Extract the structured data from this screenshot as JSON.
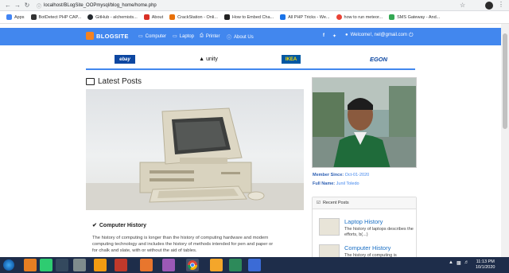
{
  "browser": {
    "url": "localhost/BLogSite_OOPmysql/blog_home/home.php",
    "bookmarks": [
      {
        "label": "Apps",
        "color": "#4285f4"
      },
      {
        "label": "BotDetect PHP CAP...",
        "color": "#333333"
      },
      {
        "label": "GitHub - alchemists...",
        "color": "#24292e"
      },
      {
        "label": "About",
        "color": "#d93025"
      },
      {
        "label": "CrackStation - Onli...",
        "color": "#e8710a"
      },
      {
        "label": "How to Embed Cha...",
        "color": "#222222"
      },
      {
        "label": "All PHP Tricks - We...",
        "color": "#1a73e8"
      },
      {
        "label": "how to run meteor...",
        "color": "#e94235"
      },
      {
        "label": "SMS Gateway - And...",
        "color": "#34a853"
      }
    ]
  },
  "nav": {
    "brand": "BLOGSITE",
    "items": [
      {
        "label": "Computer",
        "icon": "monitor-icon"
      },
      {
        "label": "Laptop",
        "icon": "laptop-icon"
      },
      {
        "label": "Printer",
        "icon": "printer-icon"
      },
      {
        "label": "About Us",
        "icon": "info-icon"
      }
    ],
    "social": {
      "facebook": "f",
      "twitter": "t"
    },
    "welcome": "Welcome!, nel@gmail.com",
    "accent": "#4287ee"
  },
  "sponsors": [
    {
      "name": "ebay"
    },
    {
      "name": "unity"
    },
    {
      "name": "IKEA"
    },
    {
      "name": "EGON"
    }
  ],
  "main": {
    "heading": "Latest Posts",
    "post": {
      "title": "Computer History",
      "body": "The history of computing is longer than the history of computing hardware and modern computing technology and includes the history of methods intended for pen and paper or for chalk and slate, with or without the aid of tables."
    }
  },
  "sidebar": {
    "member_since_label": "Member Since:",
    "member_since": "Oct-01-2020",
    "full_name_label": "Full Name:",
    "full_name": "Junil Toledo",
    "recent_heading": "Recent Posts",
    "recent": [
      {
        "title": "Laptop History",
        "desc": "The history of laptops describes the efforts, b(...)"
      },
      {
        "title": "Computer History",
        "desc": "The history of computing is"
      }
    ]
  },
  "taskbar": {
    "time": "11:13 PM",
    "date": "10/1/2020"
  }
}
